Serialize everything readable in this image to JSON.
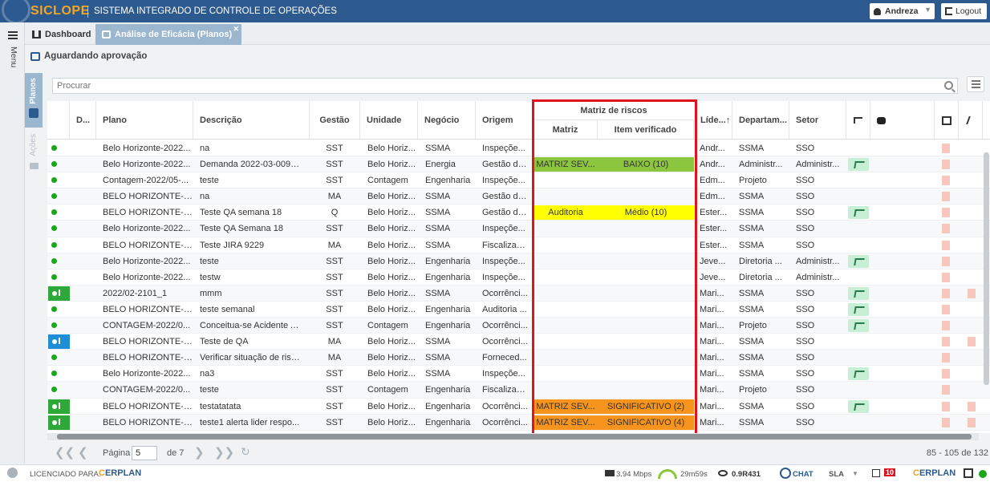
{
  "header": {
    "logo": "SICLOPE",
    "title": "SISTEMA INTEGRADO DE CONTROLE DE OPERAÇÕES",
    "user": "Andreza",
    "logout": "Logout"
  },
  "menu": {
    "label": "Menu"
  },
  "tabs": [
    {
      "label": "Dashboard"
    },
    {
      "label": "Análise de Eficácia (Planos)"
    }
  ],
  "section_title": "Aguardando aprovação",
  "side_tabs": {
    "planos": "Planos",
    "acoes": "Ações"
  },
  "search": {
    "placeholder": "Procurar"
  },
  "table": {
    "headers": {
      "d": "D...",
      "plano": "Plano",
      "descricao": "Descrição",
      "gestao": "Gestão",
      "unidade": "Unidade",
      "negocio": "Negócio",
      "origem": "Origem",
      "matriz_group": "Matriz de riscos",
      "matriz": "Matriz",
      "item": "Item verificado",
      "lider": "Líde...↑",
      "depto": "Departam...",
      "setor": "Setor"
    },
    "rows": [
      {
        "status": "dot",
        "plano": "Belo Horizonte-2022...",
        "desc": "na",
        "gestao": "SST",
        "unid": "Belo Horiz...",
        "neg": "SSMA",
        "orig": "Inspeçõe...",
        "matriz": "",
        "item": "",
        "risk": "",
        "lider": "Andr...",
        "depto": "SSMA",
        "setor": "SSO",
        "badge": false,
        "pdf2": false
      },
      {
        "status": "dot",
        "plano": "Belo Horizonte-2022...",
        "desc": "Demanda 2022-03-0092: ...",
        "gestao": "SST",
        "unid": "Belo Horiz...",
        "neg": "Energia",
        "orig": "Gestão de...",
        "matriz": "MATRIZ SEV...",
        "item": "BAIXO (10)",
        "risk": "green",
        "lider": "Andr...",
        "depto": "Administr...",
        "setor": "Administr...",
        "badge": true,
        "pdf2": false
      },
      {
        "status": "dot",
        "plano": "Contagem-2022/05-...",
        "desc": "teste",
        "gestao": "SST",
        "unid": "Contagem",
        "neg": "Engenharia",
        "orig": "Inspeçõe...",
        "matriz": "",
        "item": "",
        "risk": "",
        "lider": "Edm...",
        "depto": "Projeto",
        "setor": "SSO",
        "badge": false,
        "pdf2": false
      },
      {
        "status": "dot",
        "plano": "BELO HORIZONTE-2...",
        "desc": "na",
        "gestao": "MA",
        "unid": "Belo Horiz...",
        "neg": "SSMA",
        "orig": "Gestão de...",
        "matriz": "",
        "item": "",
        "risk": "",
        "lider": "Edm...",
        "depto": "SSMA",
        "setor": "SSO",
        "badge": false,
        "pdf2": false
      },
      {
        "status": "dot",
        "plano": "BELO HORIZONTE-2...",
        "desc": "Teste QA semana 18",
        "gestao": "Q",
        "unid": "Belo Horiz...",
        "neg": "SSMA",
        "orig": "Gestão de...",
        "matriz": "Auditoria",
        "item": "Médio (10)",
        "risk": "yellow",
        "lider": "Ester...",
        "depto": "SSMA",
        "setor": "SSO",
        "badge": true,
        "pdf2": false
      },
      {
        "status": "dot",
        "plano": "Belo Horizonte-2022...",
        "desc": "Teste QA Semana 18",
        "gestao": "SST",
        "unid": "Belo Horiz...",
        "neg": "SSMA",
        "orig": "Inspeçõe...",
        "matriz": "",
        "item": "",
        "risk": "",
        "lider": "Ester...",
        "depto": "SSMA",
        "setor": "SSO",
        "badge": false,
        "pdf2": false
      },
      {
        "status": "dot",
        "plano": "BELO HORIZONTE-2...",
        "desc": "Teste JIRA 9229",
        "gestao": "MA",
        "unid": "Belo Horiz...",
        "neg": "SSMA",
        "orig": "Fiscalizaç...",
        "matriz": "",
        "item": "",
        "risk": "",
        "lider": "Ester...",
        "depto": "SSMA",
        "setor": "SSO",
        "badge": false,
        "pdf2": false
      },
      {
        "status": "dot",
        "plano": "Belo Horizonte-2022...",
        "desc": "teste",
        "gestao": "SST",
        "unid": "Belo Horiz...",
        "neg": "Engenharia",
        "orig": "Inspeçõe...",
        "matriz": "",
        "item": "",
        "risk": "",
        "lider": "Jeve...",
        "depto": "Diretoria ...",
        "setor": "Administr...",
        "badge": true,
        "pdf2": false
      },
      {
        "status": "dot",
        "plano": "Belo Horizonte-2022...",
        "desc": "testw",
        "gestao": "SST",
        "unid": "Belo Horiz...",
        "neg": "Engenharia",
        "orig": "Inspeçõe...",
        "matriz": "",
        "item": "",
        "risk": "",
        "lider": "Jeve...",
        "depto": "Diretoria ...",
        "setor": "Administr...",
        "badge": false,
        "pdf2": false
      },
      {
        "status": "flag-green",
        "plano": "2022/02-2101_1",
        "desc": "mmm",
        "gestao": "SST",
        "unid": "Belo Horiz...",
        "neg": "SSMA",
        "orig": "Ocorrênci...",
        "matriz": "",
        "item": "",
        "risk": "",
        "lider": "Mari...",
        "depto": "SSMA",
        "setor": "SSO",
        "badge": true,
        "pdf2": true
      },
      {
        "status": "dot",
        "plano": "BELO HORIZONTE-2...",
        "desc": "teste semanal",
        "gestao": "SST",
        "unid": "Belo Horiz...",
        "neg": "Engenharia",
        "orig": "Auditoria ...",
        "matriz": "",
        "item": "",
        "risk": "",
        "lider": "Mari...",
        "depto": "SSMA",
        "setor": "SSO",
        "badge": true,
        "pdf2": false
      },
      {
        "status": "dot",
        "plano": "CONTAGEM-2022/0...",
        "desc": "Conceitua-se Acidente A...",
        "gestao": "SST",
        "unid": "Contagem",
        "neg": "Engenharia",
        "orig": "Ocorrênci...",
        "matriz": "",
        "item": "",
        "risk": "",
        "lider": "Mari...",
        "depto": "Projeto",
        "setor": "SSO",
        "badge": true,
        "pdf2": false
      },
      {
        "status": "flag-blue",
        "plano": "BELO HORIZONTE-2...",
        "desc": "Teste de QA",
        "gestao": "MA",
        "unid": "Belo Horiz...",
        "neg": "SSMA",
        "orig": "Ocorrênci...",
        "matriz": "",
        "item": "",
        "risk": "",
        "lider": "Mari...",
        "depto": "SSMA",
        "setor": "SSO",
        "badge": false,
        "pdf2": true
      },
      {
        "status": "dot",
        "plano": "BELO HORIZONTE-2...",
        "desc": "Verificar situação de risc...",
        "gestao": "MA",
        "unid": "Belo Horiz...",
        "neg": "SSMA",
        "orig": "Forneced...",
        "matriz": "",
        "item": "",
        "risk": "",
        "lider": "Mari...",
        "depto": "SSMA",
        "setor": "SSO",
        "badge": false,
        "pdf2": false
      },
      {
        "status": "dot",
        "plano": "Belo Horizonte-2022...",
        "desc": "na3",
        "gestao": "SST",
        "unid": "Belo Horiz...",
        "neg": "SSMA",
        "orig": "Inspeçõe...",
        "matriz": "",
        "item": "",
        "risk": "",
        "lider": "Mari...",
        "depto": "SSMA",
        "setor": "SSO",
        "badge": true,
        "pdf2": false
      },
      {
        "status": "dot",
        "plano": "CONTAGEM-2022/0...",
        "desc": "teste",
        "gestao": "SST",
        "unid": "Contagem",
        "neg": "Engenharia",
        "orig": "Fiscalizaç...",
        "matriz": "",
        "item": "",
        "risk": "",
        "lider": "Mari...",
        "depto": "Projeto",
        "setor": "SSO",
        "badge": false,
        "pdf2": false
      },
      {
        "status": "flag-green",
        "plano": "BELO HORIZONTE-2...",
        "desc": "testatatata",
        "gestao": "SST",
        "unid": "Belo Horiz...",
        "neg": "Engenharia",
        "orig": "Ocorrênci...",
        "matriz": "MATRIZ SEV...",
        "item": "SIGNIFICATIVO (2)",
        "risk": "orange",
        "lider": "Mari...",
        "depto": "SSMA",
        "setor": "SSO",
        "badge": true,
        "pdf2": true
      },
      {
        "status": "flag-green",
        "plano": "BELO HORIZONTE-2...",
        "desc": "teste1 alerta lider respo...",
        "gestao": "SST",
        "unid": "Belo Horiz...",
        "neg": "Engenharia",
        "orig": "Ocorrênci...",
        "matriz": "MATRIZ SEV...",
        "item": "SIGNIFICATIVO (4)",
        "risk": "orange",
        "lider": "Mari...",
        "depto": "SSMA",
        "setor": "SSO",
        "badge": false,
        "pdf2": true
      }
    ]
  },
  "colors": {
    "header_bg": "#2d5a8e",
    "logo": "#f5a623",
    "risk_green": "#8cc63f",
    "risk_yellow": "#ffff00",
    "risk_orange": "#f7941d",
    "status_green": "#1aa61a",
    "flag_green": "#2fa83a",
    "flag_blue": "#1e8fd6",
    "highlight": "#e0141e"
  },
  "pager": {
    "page_label": "Página",
    "page": "5",
    "of_label": "de 7",
    "count": "85 - 105 de 132"
  },
  "statusbar": {
    "licensed": "LICENCIADO PARA:",
    "erplan_c": "C",
    "erplan": "ERPLAN",
    "speed": "3.94 Mbps",
    "timer": "29m59s",
    "version": "0.9R431",
    "chat": "CHAT",
    "sla": "SLA",
    "notif": "10"
  }
}
